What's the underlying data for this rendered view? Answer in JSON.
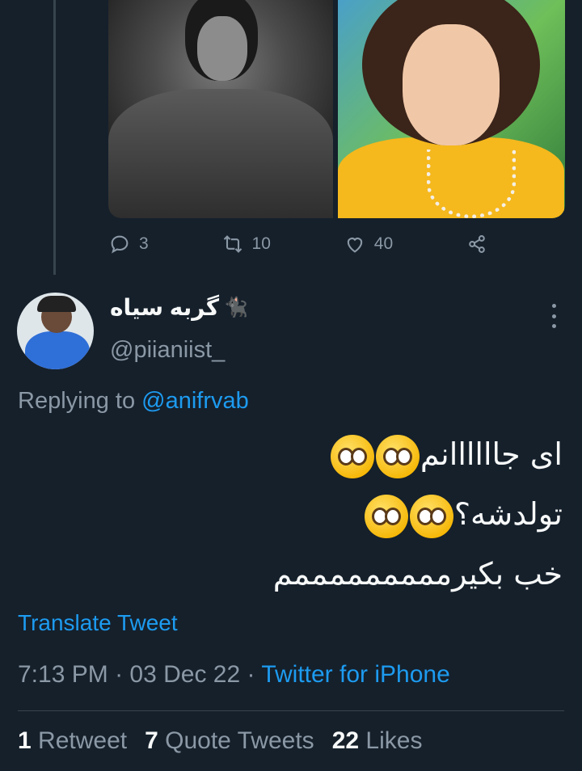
{
  "previous_tweet": {
    "actions": {
      "replies": "3",
      "retweets": "10",
      "likes": "40"
    }
  },
  "tweet": {
    "author": {
      "display_name": "گربه سیاه",
      "name_emoji": "🐈‍⬛",
      "handle": "@piianiist_"
    },
    "replying_prefix": "Replying to ",
    "replying_to": "@anifrvab",
    "text_lines": [
      "ای جاااااانم",
      "تولدشه؟",
      "خب بکیرمممممممممم"
    ],
    "translate_label": "Translate Tweet",
    "time": "7:13 PM",
    "date": "03 Dec 22",
    "client": "Twitter for iPhone",
    "separator": "·",
    "stats": {
      "retweets_count": "1",
      "retweets_label": "Retweet",
      "quotes_count": "7",
      "quotes_label": "Quote Tweets",
      "likes_count": "22",
      "likes_label": "Likes"
    }
  },
  "colors": {
    "background": "#15202b",
    "text": "#f7f9f9",
    "muted": "#8b98a5",
    "accent": "#1d9bf0",
    "divider": "#38444d"
  },
  "icons": [
    "reply-icon",
    "retweet-icon",
    "like-icon",
    "share-icon",
    "more-options-icon",
    "pleading-face-emoji"
  ]
}
